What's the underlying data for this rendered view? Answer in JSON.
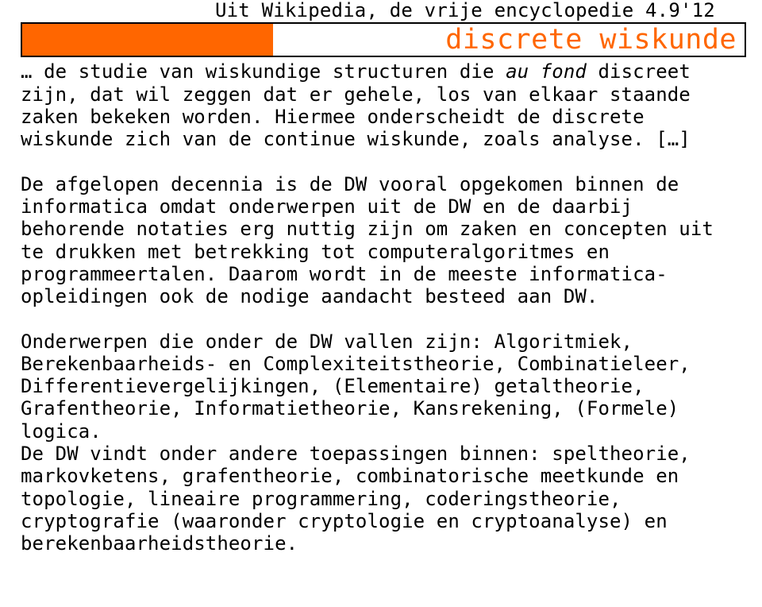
{
  "header": {
    "source_line": "Uit Wikipedia, de vrije encyclopedie 4.9'12",
    "title": "discrete wiskunde"
  },
  "paragraphs": {
    "p1_prefix": "de studie van wiskundige structuren die ",
    "p1_italic": "au fond",
    "p1_suffix": " discreet zijn, dat wil zeggen dat er gehele, los van elkaar staande zaken bekeken worden. Hiermee onderscheidt de discrete wiskunde zich van de continue wiskunde, zoals analyse. […]",
    "p2": "De afgelopen decennia is de DW vooral opgekomen binnen de informatica omdat onderwerpen uit de DW en de daarbij behorende notaties erg nuttig zijn om zaken en concepten uit te drukken met betrekking tot computeralgoritmes en programmeertalen. Daarom wordt in de meeste informatica-opleidingen ook de nodige aandacht besteed aan DW.",
    "p3": "Onderwerpen die onder de DW vallen zijn: Algoritmiek, Berekenbaarheids- en Complexiteitstheorie, Combinatieleer, Differentievergelijkingen, (Elementaire) getaltheorie, Grafentheorie, Informatietheorie, Kansrekening, (Formele) logica.",
    "p4": "De DW vindt onder andere toepassingen binnen: speltheorie, markovketens, grafentheorie, combinatorische meetkunde en topologie, lineaire programmering, coderingstheorie, cryptografie (waaronder cryptologie en cryptoanalyse) en berekenbaarheidstheorie."
  }
}
